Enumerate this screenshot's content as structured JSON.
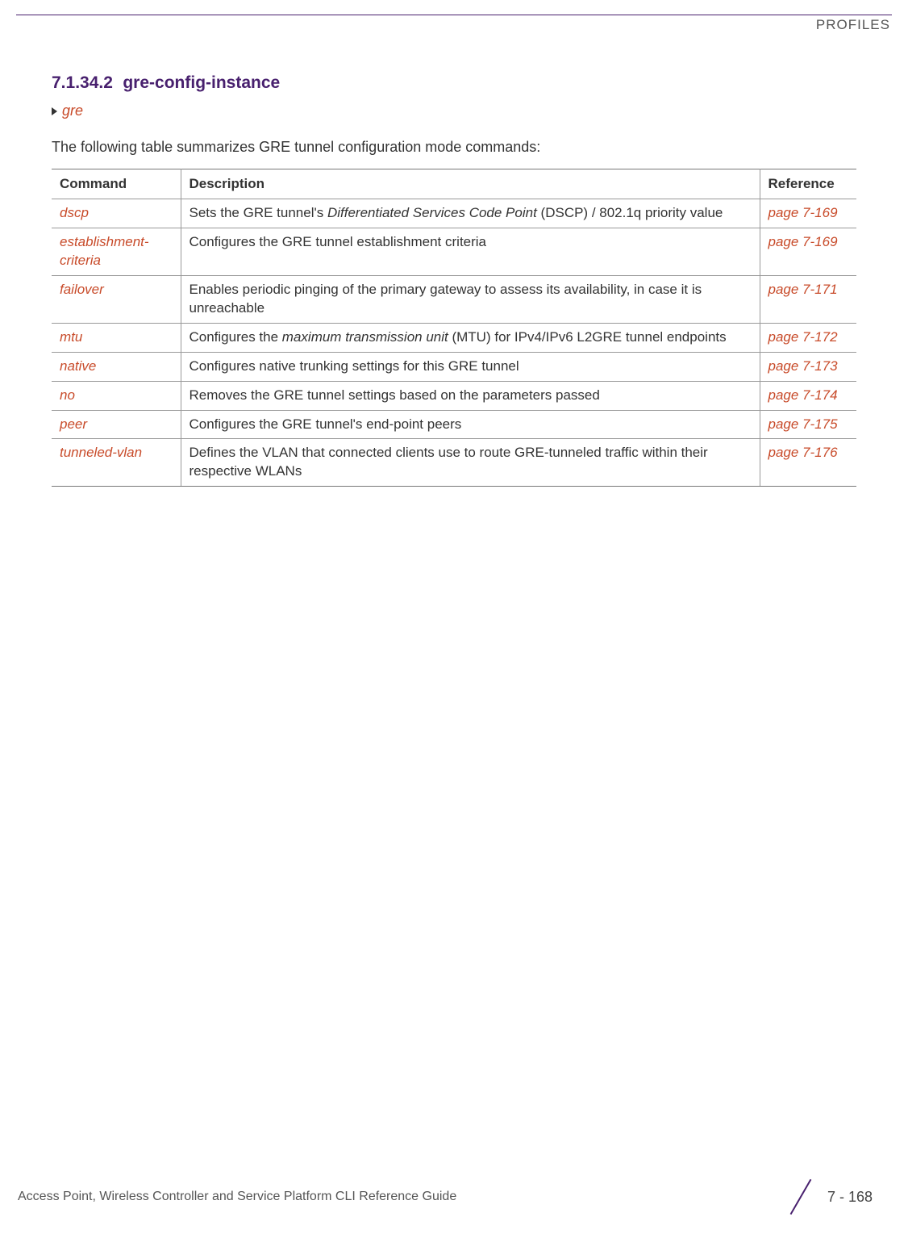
{
  "header": {
    "label": "PROFILES"
  },
  "section": {
    "number": "7.1.34.2",
    "title": "gre-config-instance"
  },
  "breadcrumb": {
    "text": "gre"
  },
  "intro": "The following table summarizes GRE tunnel configuration mode commands:",
  "table": {
    "headers": {
      "command": "Command",
      "description": "Description",
      "reference": "Reference"
    },
    "rows": [
      {
        "command": "dscp",
        "description_prefix": "Sets the GRE tunnel's ",
        "description_italic": "Differentiated Services Code Point",
        "description_suffix": " (DSCP) / 802.1q priority value",
        "reference": "page 7-169"
      },
      {
        "command": "establishment-criteria",
        "description_prefix": "Configures the GRE tunnel establishment criteria",
        "description_italic": "",
        "description_suffix": "",
        "reference": "page 7-169"
      },
      {
        "command": "failover",
        "description_prefix": "Enables periodic pinging of the primary gateway to assess its availability, in case it is unreachable",
        "description_italic": "",
        "description_suffix": "",
        "reference": "page 7-171"
      },
      {
        "command": "mtu",
        "description_prefix": "Configures the ",
        "description_italic": "maximum transmission unit",
        "description_suffix": " (MTU) for IPv4/IPv6 L2GRE tunnel endpoints",
        "reference": "page 7-172"
      },
      {
        "command": "native",
        "description_prefix": "Configures native trunking settings for this GRE tunnel",
        "description_italic": "",
        "description_suffix": "",
        "reference": "page 7-173"
      },
      {
        "command": "no",
        "description_prefix": "Removes the GRE tunnel settings based on the parameters passed",
        "description_italic": "",
        "description_suffix": "",
        "reference": "page 7-174"
      },
      {
        "command": "peer",
        "description_prefix": "Configures the GRE tunnel's end-point peers",
        "description_italic": "",
        "description_suffix": "",
        "reference": "page 7-175"
      },
      {
        "command": "tunneled-vlan",
        "description_prefix": "Defines the VLAN that connected clients use to route GRE-tunneled traffic within their respective WLANs",
        "description_italic": "",
        "description_suffix": "",
        "reference": "page 7-176"
      }
    ]
  },
  "footer": {
    "guide": "Access Point, Wireless Controller and Service Platform CLI Reference Guide",
    "page": "7 - 168"
  }
}
